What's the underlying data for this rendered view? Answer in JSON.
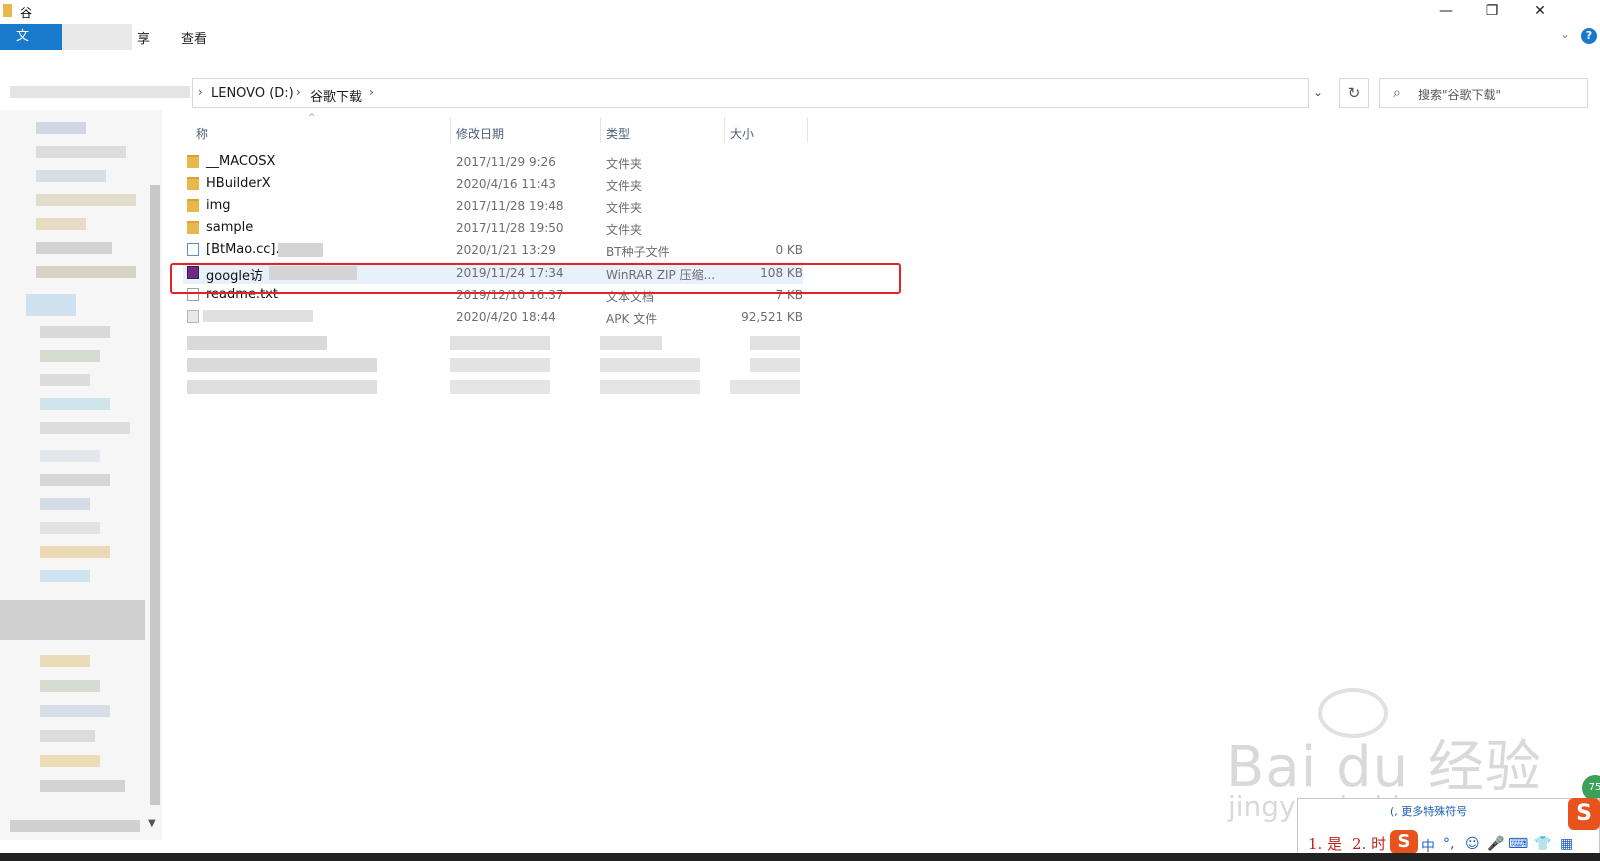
{
  "window": {
    "title": "谷",
    "controls": {
      "minimize": "—",
      "maximize": "❐",
      "close": "✕"
    }
  },
  "ribbon": {
    "tabs": [
      {
        "label": "文"
      },
      {
        "label": "享"
      },
      {
        "label": "查看"
      }
    ],
    "help": "?",
    "expand": "⌄"
  },
  "address": {
    "breadcrumbs": [
      "LENOVO (D:)",
      "谷歌下载"
    ],
    "separator": "›",
    "dropdown": "⌄",
    "refresh": "↻"
  },
  "search": {
    "icon": "search-icon",
    "placeholder": "搜索\"谷歌下载\""
  },
  "columns": {
    "name": "称",
    "date": "修改日期",
    "type": "类型",
    "size": "大小"
  },
  "files": [
    {
      "name": "__MACOSX",
      "date": "2017/11/29 9:26",
      "type": "文件夹",
      "size": "",
      "icon": "folder-icon"
    },
    {
      "name": "HBuilderX",
      "date": "2020/4/16 11:43",
      "type": "文件夹",
      "size": "",
      "icon": "folder-icon"
    },
    {
      "name": "img",
      "date": "2017/11/28 19:48",
      "type": "文件夹",
      "size": "",
      "icon": "folder-icon"
    },
    {
      "name": "sample",
      "date": "2017/11/28 19:50",
      "type": "文件夹",
      "size": "",
      "icon": "folder-icon"
    },
    {
      "name": "[BtMao.cc].t",
      "date": "2020/1/21 13:29",
      "type": "BT种子文件",
      "size": "0 KB",
      "icon": "torrent-icon"
    },
    {
      "name": "google访",
      "date": "2019/11/24 17:34",
      "type": "WinRAR ZIP 压缩...",
      "size": "108 KB",
      "icon": "zip-icon"
    },
    {
      "name": "readme.txt",
      "date": "2019/12/10 16:37",
      "type": "文本文档",
      "size": "7 KB",
      "icon": "text-file-icon"
    },
    {
      "name": "",
      "date": "2020/4/20 18:44",
      "type": "APK 文件",
      "size": "92,521 KB",
      "icon": "apk-icon"
    }
  ],
  "watermark": {
    "brand": "Bai du 经验",
    "url": "jingyan.baidu.com"
  },
  "ime": {
    "hint": "(, 更多特殊符号",
    "candidates": [
      "1. 是",
      "2. 时"
    ],
    "logo": "S",
    "tools": [
      "中",
      "°,",
      "☺",
      "🎤",
      "⌨",
      "👕",
      "▦"
    ],
    "badge": "75"
  },
  "colors": {
    "accent": "#1979ca",
    "highlight": "#e0242a",
    "folder": "#e8b84a",
    "sogou": "#e8531d"
  }
}
